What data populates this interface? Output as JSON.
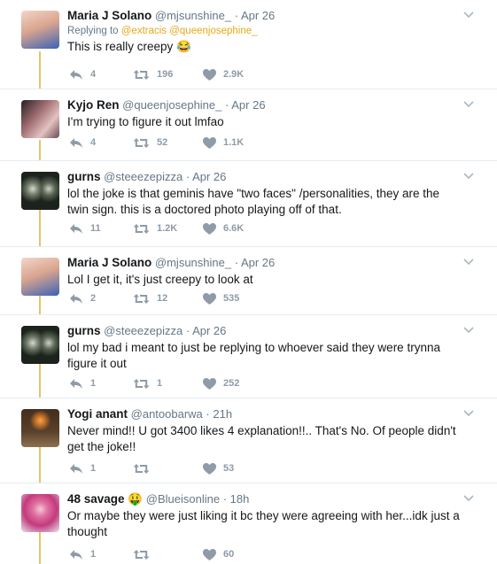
{
  "tweets": [
    {
      "name": "Maria J Solano",
      "handle": "@mjsunshine_",
      "time": "Apr 26",
      "replying_prefix": "Replying to",
      "replying_to": "@extracis @queenjosephine_",
      "text": "This is really creepy 😂",
      "replies": "4",
      "retweets": "196",
      "likes": "2.9K"
    },
    {
      "name": "Kyjo Ren",
      "handle": "@queenjosephine_",
      "time": "Apr 26",
      "text": "I'm trying to figure it out lmfao",
      "replies": "4",
      "retweets": "52",
      "likes": "1.1K"
    },
    {
      "name": "gurns",
      "handle": "@steeezepizza",
      "time": "Apr 26",
      "text": "lol the joke is that geminis have \"two faces\" /personalities, they are the twin sign. this is a doctored photo playing off of that.",
      "replies": "11",
      "retweets": "1.2K",
      "likes": "6.6K"
    },
    {
      "name": "Maria J Solano",
      "handle": "@mjsunshine_",
      "time": "Apr 26",
      "text": "Lol I get it, it's just creepy to look at",
      "replies": "2",
      "retweets": "12",
      "likes": "535"
    },
    {
      "name": "gurns",
      "handle": "@steeezepizza",
      "time": "Apr 26",
      "text": "lol my bad i meant to just be replying to whoever said they were trynna figure it out",
      "replies": "1",
      "retweets": "1",
      "likes": "252"
    },
    {
      "name": "Yogi anant",
      "handle": "@antoobarwa",
      "time": "21h",
      "text": "Never mind!! U got 3400 likes 4 explanation!!.. That's No. Of people didn't get the joke!!",
      "replies": "1",
      "retweets": "",
      "likes": "53"
    },
    {
      "name": "48 savage 🤑",
      "handle": "@Blueisonline",
      "time": "18h",
      "text": "Or maybe they were just liking it bc they were agreeing with her...idk just a thought",
      "replies": "1",
      "retweets": "",
      "likes": "60"
    }
  ],
  "ui": {
    "dot": "·"
  },
  "colors": {
    "thread_line": "#e6c36a",
    "mention": "#e6a817",
    "icon": "#8e9ba8"
  }
}
